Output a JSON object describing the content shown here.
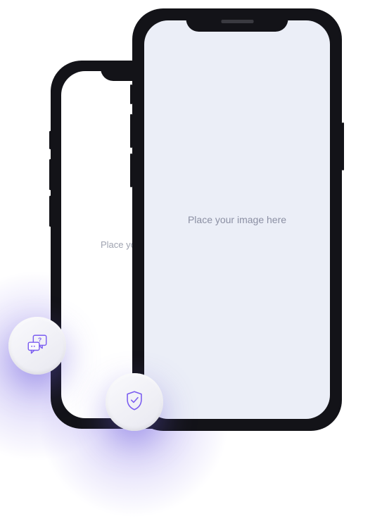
{
  "phones": {
    "back": {
      "placeholder": "Place your image here"
    },
    "front": {
      "placeholder": "Place your image here"
    }
  },
  "icons": {
    "chat": "chat-question-icon",
    "shield": "shield-check-icon"
  },
  "colors": {
    "accent": "#7a5cf0",
    "screenFront": "#ebeef7",
    "screenBack": "#ffffff"
  }
}
